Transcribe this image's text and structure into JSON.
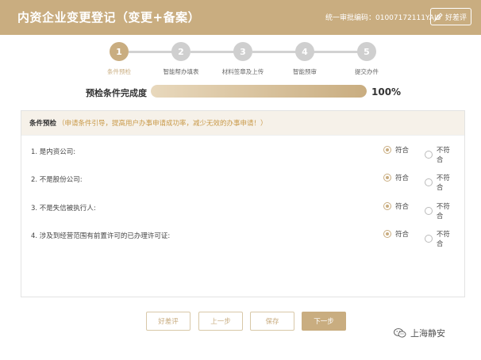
{
  "header": {
    "title": "内资企业变更登记（变更+备案）",
    "code": "统一审批编码：01007172111YAJ8",
    "rate_label": "好差评"
  },
  "steps": [
    {
      "num": "1",
      "label": "条件预检",
      "active": true
    },
    {
      "num": "2",
      "label": "智能帮办填表",
      "active": false
    },
    {
      "num": "3",
      "label": "材料签章及上传",
      "active": false
    },
    {
      "num": "4",
      "label": "智能预审",
      "active": false
    },
    {
      "num": "5",
      "label": "提交办件",
      "active": false
    }
  ],
  "progress": {
    "label": "预检条件完成度",
    "value_text": "100%",
    "fraction": 1.0
  },
  "panel": {
    "title": "条件预检",
    "note": "（申请条件引导，提高用户办事申请成功率，减少无效的办事申请！）",
    "questions": [
      {
        "text": "1. 是内资公司:",
        "yes": "符合",
        "no": "不符合",
        "selected": "yes"
      },
      {
        "text": "2. 不是股份公司:",
        "yes": "符合",
        "no": "不符合",
        "selected": "yes"
      },
      {
        "text": "3. 不是失信被执行人:",
        "yes": "符合",
        "no": "不符合",
        "selected": "yes"
      },
      {
        "text": "4. 涉及到经营范围有前置许可的已办理许可证:",
        "yes": "符合",
        "no": "不符合",
        "selected": "yes"
      }
    ]
  },
  "buttons": {
    "rate": "好差评",
    "prev": "上一步",
    "save": "保存",
    "next": "下一步"
  },
  "watermark": {
    "text": "上海静安",
    "icon": "wechat-icon"
  },
  "colors": {
    "accent": "#c9ad80",
    "note": "#c99a4a"
  }
}
